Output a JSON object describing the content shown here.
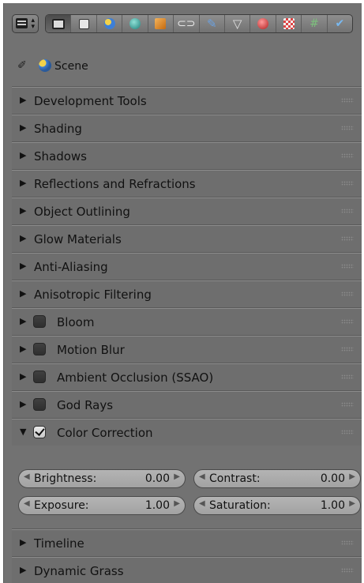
{
  "toolbar": {
    "editor_type_icon": "properties-editor-icon",
    "contexts": [
      {
        "icon": "render-icon",
        "active": true
      },
      {
        "icon": "render-layers-icon",
        "active": false
      },
      {
        "icon": "scene-icon",
        "active": false
      },
      {
        "icon": "world-icon",
        "active": false
      },
      {
        "icon": "object-icon",
        "active": false
      },
      {
        "icon": "constraints-icon",
        "active": false
      },
      {
        "icon": "modifiers-icon",
        "active": false
      },
      {
        "icon": "data-icon",
        "active": false
      },
      {
        "icon": "material-icon",
        "active": false
      },
      {
        "icon": "texture-icon",
        "active": false
      },
      {
        "icon": "particles-icon",
        "active": false
      },
      {
        "icon": "physics-icon",
        "active": false
      }
    ]
  },
  "scene": {
    "label": "Scene",
    "pin_icon": "pin-icon"
  },
  "panels": [
    {
      "label": "Development Tools"
    },
    {
      "label": "Shading"
    },
    {
      "label": "Shadows"
    },
    {
      "label": "Reflections and Refractions"
    },
    {
      "label": "Object Outlining"
    },
    {
      "label": "Glow Materials"
    },
    {
      "label": "Anti-Aliasing"
    },
    {
      "label": "Anisotropic Filtering"
    },
    {
      "label": "Bloom",
      "checkbox": false
    },
    {
      "label": "Motion Blur",
      "checkbox": false
    },
    {
      "label": "Ambient Occlusion (SSAO)",
      "checkbox": false
    },
    {
      "label": "God Rays",
      "checkbox": false
    },
    {
      "label": "Color Correction",
      "checkbox": true,
      "expanded": true
    },
    {
      "label": "Timeline"
    },
    {
      "label": "Dynamic Grass"
    }
  ],
  "color_correction": {
    "brightness": {
      "label": "Brightness:",
      "value": "0.00"
    },
    "contrast": {
      "label": "Contrast:",
      "value": "0.00"
    },
    "exposure": {
      "label": "Exposure:",
      "value": "1.00"
    },
    "saturation": {
      "label": "Saturation:",
      "value": "1.00"
    }
  },
  "colors": {
    "panel_bg": "#727272",
    "field_bg": "#ababab",
    "header_text": "#111111"
  }
}
